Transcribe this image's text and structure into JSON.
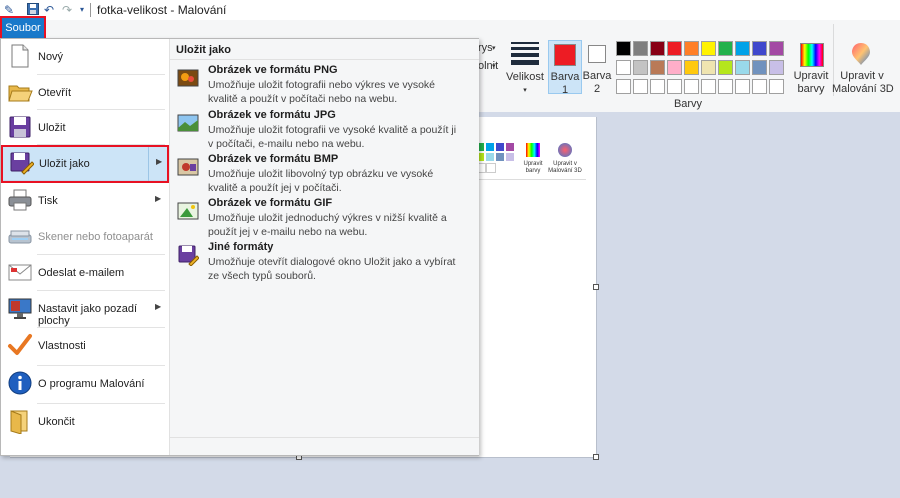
{
  "window": {
    "title": "fotka-velikost - Malování",
    "qa_icons": [
      "paint-app-icon",
      "save-icon",
      "undo-icon",
      "redo-icon",
      "customize-arrow-icon"
    ]
  },
  "ribbon": {
    "file_tab": "Soubor",
    "partial_labels": [
      "rys",
      "olnit"
    ],
    "size_label": "Velikost",
    "color1_label": "Barva\n1",
    "color2_label": "Barva\n2",
    "edit_colors_label": "Upravit\nbarvy",
    "paint3d_label": "Upravit v\nMalování 3D",
    "group_colors_label": "Barvy",
    "color1": "#ed1c24",
    "color2": "#ffffff",
    "palette_row1": [
      "#000000",
      "#7f7f7f",
      "#880015",
      "#ed1c24",
      "#ff7f27",
      "#fff200",
      "#22b14c",
      "#00a2e8",
      "#3f48cc",
      "#a349a4"
    ],
    "palette_row2": [
      "#ffffff",
      "#c3c3c3",
      "#b97a57",
      "#ffaec9",
      "#ffc90e",
      "#efe4b0",
      "#b5e61d",
      "#99d9ea",
      "#7092be",
      "#c8bfe7"
    ],
    "palette_row3": [
      "#ffffff",
      "#ffffff",
      "#ffffff",
      "#ffffff",
      "#ffffff",
      "#ffffff",
      "#ffffff",
      "#ffffff",
      "#ffffff",
      "#ffffff"
    ]
  },
  "canvas_preview": {
    "edit_colors_label": "Upravit\nbarvy",
    "paint3d_label": "Upravit v\nMalování 3D"
  },
  "menu": {
    "items": [
      {
        "label": "Nový",
        "icon": "new-file-icon",
        "arrow": false,
        "disabled": false
      },
      {
        "label": "Otevřít",
        "icon": "open-folder-icon",
        "arrow": false,
        "disabled": false
      },
      {
        "label": "Uložit",
        "icon": "save-disk-icon",
        "arrow": false,
        "disabled": false
      },
      {
        "label": "Uložit jako",
        "icon": "save-as-icon",
        "arrow": true,
        "disabled": false
      },
      {
        "label": "Tisk",
        "icon": "printer-icon",
        "arrow": true,
        "disabled": false
      },
      {
        "label": "Skener nebo fotoaparát",
        "icon": "scanner-icon",
        "arrow": false,
        "disabled": true
      },
      {
        "label": "Odeslat e-mailem",
        "icon": "email-icon",
        "arrow": false,
        "disabled": false
      },
      {
        "label": "Nastavit jako pozadí plochy",
        "icon": "desktop-background-icon",
        "arrow": true,
        "disabled": false
      },
      {
        "label": "Vlastnosti",
        "icon": "checkmark-icon",
        "arrow": false,
        "disabled": false
      },
      {
        "label": "O programu Malování",
        "icon": "info-icon",
        "arrow": false,
        "disabled": false
      },
      {
        "label": "Ukončit",
        "icon": "exit-folder-icon",
        "arrow": false,
        "disabled": false
      }
    ],
    "submenu": {
      "title": "Uložit jako",
      "items": [
        {
          "title": "Obrázek ve formátu PNG",
          "desc": "Umožňuje uložit fotografii nebo výkres ve vysoké kvalitě a použít v počítači nebo na webu.",
          "icon": "png-image-icon"
        },
        {
          "title": "Obrázek ve formátu JPG",
          "desc": "Umožňuje uložit fotografii ve vysoké kvalitě a použít ji v počítači, e-mailu nebo na webu.",
          "icon": "jpg-image-icon"
        },
        {
          "title": "Obrázek ve formátu BMP",
          "desc": "Umožňuje uložit libovolný typ obrázku ve vysoké kvalitě a použít jej v počítači.",
          "icon": "bmp-image-icon"
        },
        {
          "title": "Obrázek ve formátu GIF",
          "desc": "Umožňuje uložit jednoduchý výkres v nižší kvalitě a použít jej v e-mailu nebo na webu.",
          "icon": "gif-image-icon"
        },
        {
          "title": "Jiné formáty",
          "desc": "Umožňuje otevřít dialogové okno Uložit jako a vybírat ze všech typů souborů.",
          "icon": "other-formats-icon"
        }
      ]
    }
  },
  "colors": {
    "accent": "#1979ca",
    "highlight": "#e81123",
    "hover": "#cce4f7"
  }
}
